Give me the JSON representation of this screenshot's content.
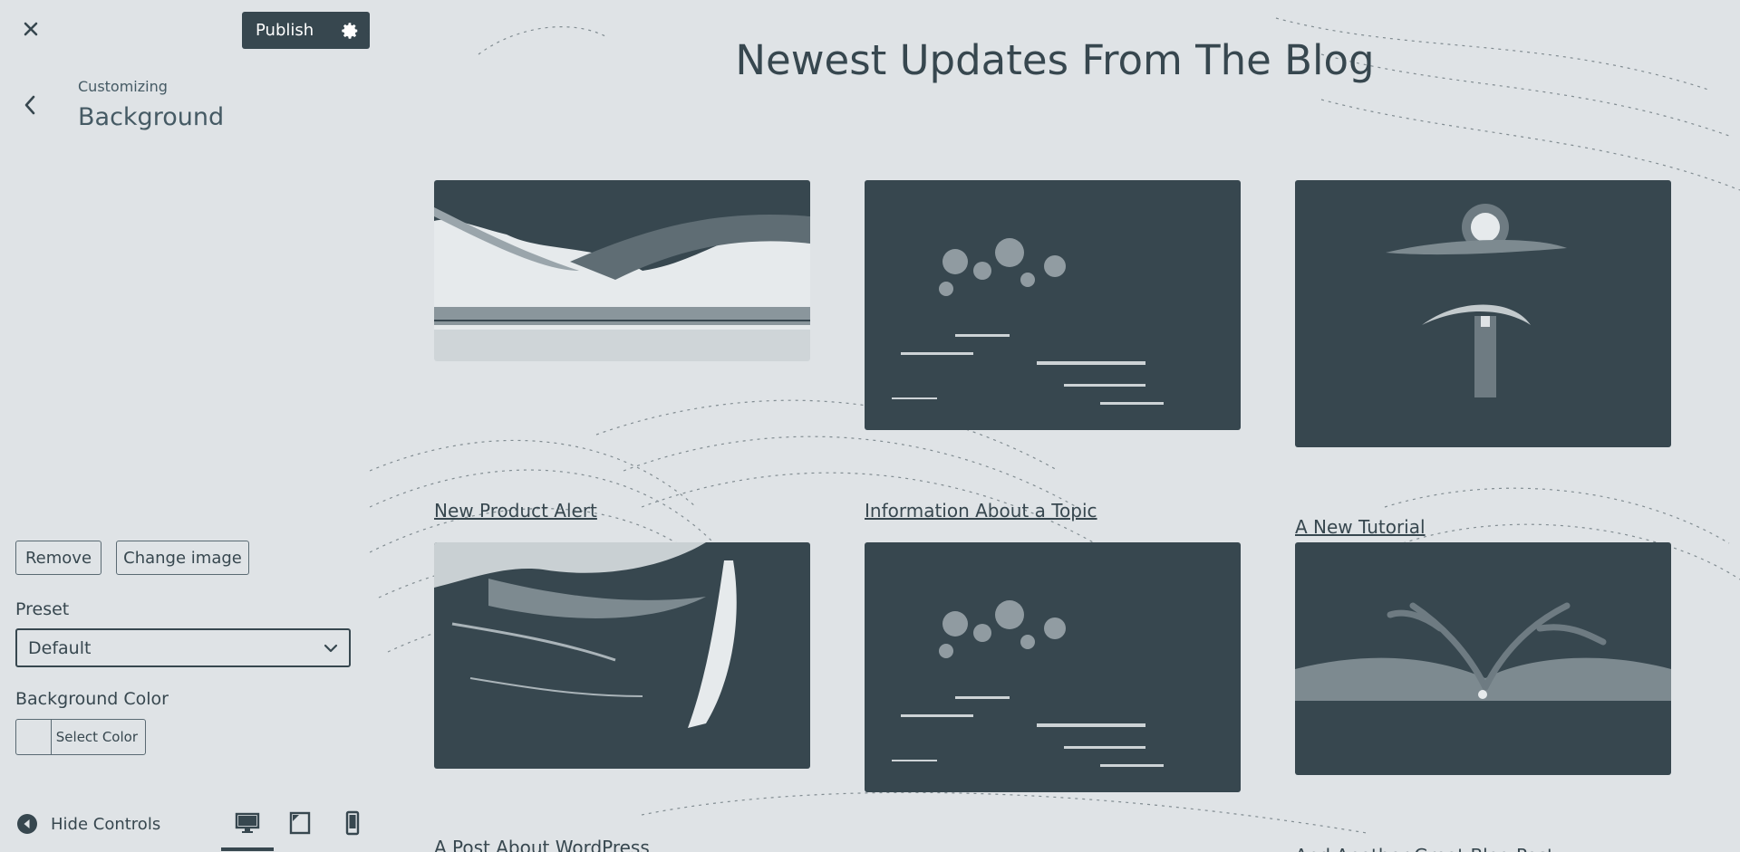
{
  "sidebar": {
    "close_icon": "close-icon",
    "publish_label": "Publish",
    "settings_icon": "gear-icon",
    "back_icon": "chevron-left-icon",
    "breadcrumb": "Customizing",
    "section_title": "Background",
    "remove_label": "Remove",
    "change_image_label": "Change image",
    "preset_label": "Preset",
    "preset_value": "Default",
    "bg_color_label": "Background Color",
    "select_color_label": "Select Color",
    "hide_controls_label": "Hide Controls",
    "devices": [
      "desktop-icon",
      "tablet-icon",
      "mobile-icon"
    ],
    "active_device": "desktop"
  },
  "preview": {
    "heading": "Newest Updates From The Blog",
    "posts": [
      {
        "title": "New Product Alert",
        "image": "sky-horizon"
      },
      {
        "title": "Information About a Topic",
        "image": "forest-lake"
      },
      {
        "title": "A New Tutorial",
        "image": "moonlit-river"
      },
      {
        "title": "A Post About WordPress",
        "image": "waterfall"
      },
      {
        "title": "",
        "image": "forest-lake"
      },
      {
        "title": "And Another Great Blog Post",
        "image": "tree-silhouette"
      }
    ]
  },
  "colors": {
    "accent": "#37474f",
    "background": "#dfe3e6",
    "text": "#37474f"
  }
}
